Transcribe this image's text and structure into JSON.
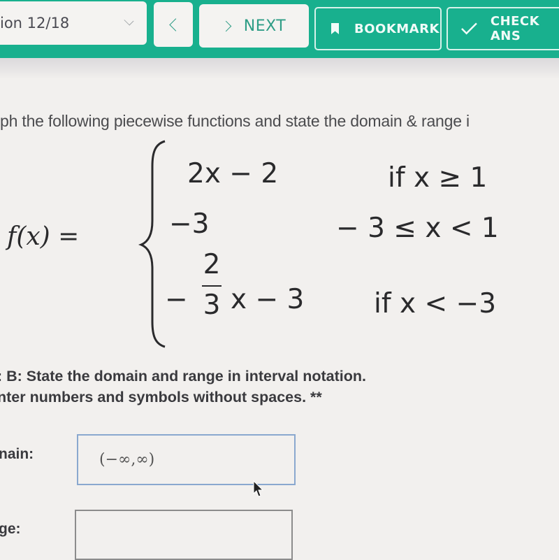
{
  "toolbar": {
    "question_selector": "ion 12/18",
    "prev_label": "<",
    "next_label": "NEXT",
    "bookmark_label": "BOOKMARK",
    "check_label": "CHECK ANS",
    "accent_color": "#18b08e"
  },
  "question": {
    "instruction": "ph the following piecewise functions and state the domain & range i",
    "function_lhs": "f(x) =",
    "cases": [
      {
        "expression": "2x − 2",
        "condition": "if x ≥ 1"
      },
      {
        "expression": "−3",
        "condition": "− 3 ≤ x < 1"
      },
      {
        "expression_sign": "−",
        "fraction_numerator": "2",
        "fraction_denominator": "3",
        "expression_rest": "x − 3",
        "condition": "if x < −3"
      }
    ]
  },
  "part_b": {
    "line1": ": B: State the domain and range in interval notation.",
    "line2": "nter numbers and symbols without spaces. **"
  },
  "fields": {
    "domain_label": "nain:",
    "domain_value": "(−∞,∞)",
    "range_label": "ge:",
    "range_value": ""
  },
  "icons": {
    "dropdown": "chevron-down-icon",
    "prev": "chevron-left-icon",
    "next": "chevron-right-icon",
    "bookmark": "bookmark-icon",
    "check": "check-icon",
    "cursor": "mouse-pointer-icon"
  }
}
